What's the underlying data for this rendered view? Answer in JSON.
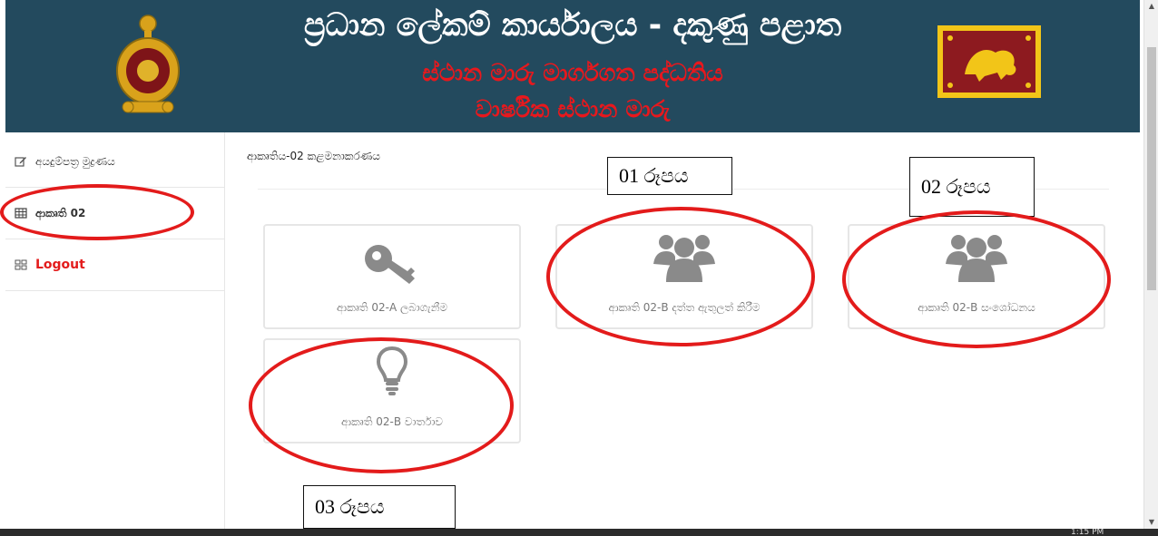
{
  "banner": {
    "title": "ප්‍රධාන ලේකම් කාර්යාලය - දකුණු පළාත",
    "subtitle1": "ස්ථාන මාරු මාර්ගගත පද්ධතිය",
    "subtitle2": "වාර්ෂික ස්ථාන මාරු"
  },
  "sidebar": {
    "items": [
      {
        "label": "අයදුම්පත්‍ර මුද්‍රණය",
        "icon": "edit-icon"
      },
      {
        "label": "ආකෘති 02",
        "icon": "table-icon"
      },
      {
        "label": "Logout",
        "icon": "grid-icon"
      }
    ]
  },
  "main": {
    "title": "ආකෘතිය-02 කළමනාකරණය",
    "tiles": [
      {
        "label": "ආකෘති 02-A ලබාගැනීම",
        "icon": "key-icon"
      },
      {
        "label": "ආකෘති 02-B දත්ත ඇතුලත් කිරීම",
        "icon": "users-icon"
      },
      {
        "label": "ආකෘති 02-B සංශෝධනය",
        "icon": "users-icon"
      },
      {
        "label": "ආකෘති 02-B වාර්තාව",
        "icon": "lightbulb-icon"
      }
    ]
  },
  "annotations": {
    "box1": "01 රූපය",
    "box2": "02 රූපය",
    "box3": "03 රූපය"
  },
  "taskbar": {
    "clock": "1:15 PM"
  },
  "colors": {
    "banner": "#234a5e",
    "accent_red": "#e31b1b",
    "tile_icon": "#8a8a8a"
  }
}
